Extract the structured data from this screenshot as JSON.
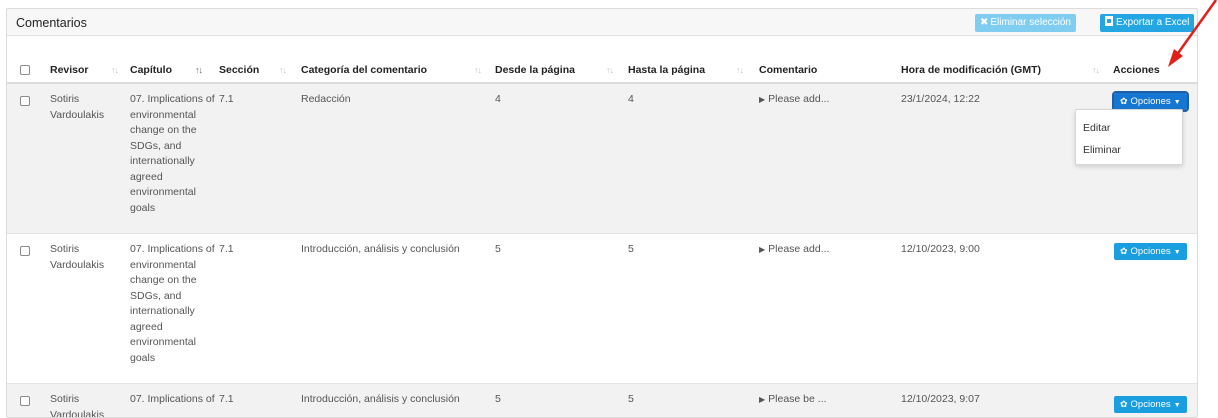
{
  "card": {
    "title": "Comentarios",
    "delete_selection_label": "Eliminar selección",
    "export_excel_label": "Exportar a Excel"
  },
  "columns": {
    "reviewer": "Revisor",
    "chapter": "Capítulo",
    "section": "Sección",
    "category": "Categoría del comentario",
    "from_page": "Desde la página",
    "to_page": "Hasta la página",
    "comment": "Comentario",
    "modified": "Hora de modificación (GMT)",
    "actions": "Acciones"
  },
  "rows": [
    {
      "reviewer": "Sotiris Vardoulakis",
      "chapter": "07. Implications of environmental change on the SDGs, and internationally agreed environmental goals",
      "section": "7.1",
      "category": "Redacción",
      "from_page": "4",
      "to_page": "4",
      "comment": "Please add...",
      "modified": "23/1/2024, 12:22",
      "action_label": "Opciones"
    },
    {
      "reviewer": "Sotiris Vardoulakis",
      "chapter": "07. Implications of environmental change on the SDGs, and internationally agreed environmental goals",
      "section": "7.1",
      "category": "Introducción, análisis y conclusión",
      "from_page": "5",
      "to_page": "5",
      "comment": "Please add...",
      "modified": "12/10/2023, 9:00",
      "action_label": "Opciones"
    },
    {
      "reviewer": "Sotiris Vardoulakis",
      "chapter": "07. Implications of",
      "section": "7.1",
      "category": "Introducción, análisis y conclusión",
      "from_page": "5",
      "to_page": "5",
      "comment": "Please be ...",
      "modified": "12/10/2023, 9:07",
      "action_label": "Opciones"
    }
  ],
  "dropdown": {
    "edit": "Editar",
    "delete": "Eliminar"
  },
  "colors": {
    "primary": "#1a9ee0",
    "delete_disabled": "#7fcdf0",
    "arrow": "#e0201b"
  },
  "icons": [
    "times-icon",
    "file-excel-icon",
    "sort-icon",
    "gear-icon",
    "caret-down-icon",
    "caret-right-icon",
    "red-arrow-annotation"
  ]
}
